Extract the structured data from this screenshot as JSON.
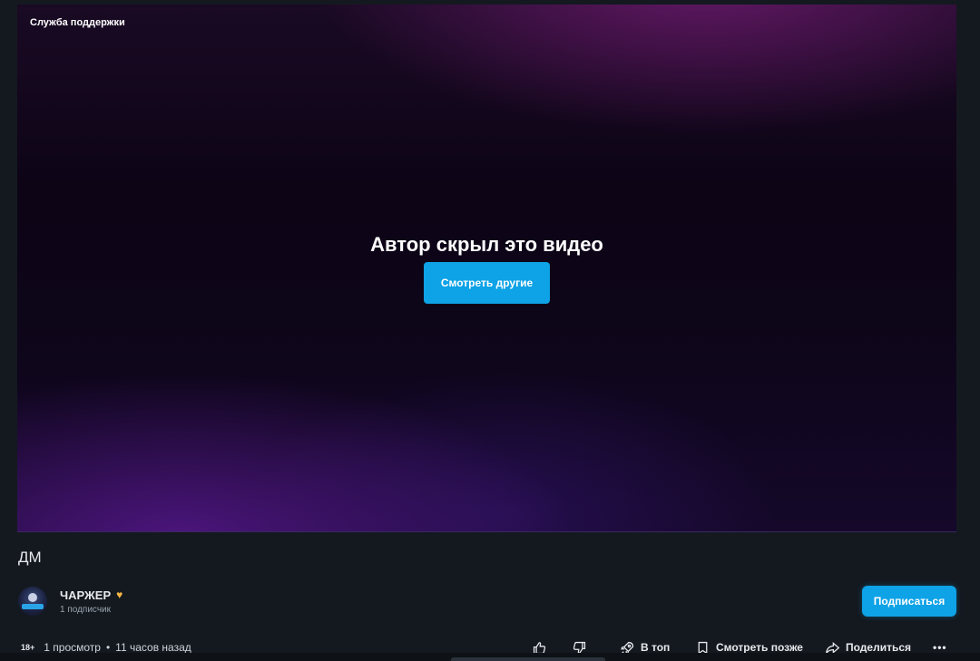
{
  "player": {
    "support_label": "Служба поддержки",
    "hidden_message": "Автор скрыл это видео",
    "watch_others_label": "Смотреть другие"
  },
  "video": {
    "title": "ДМ"
  },
  "channel": {
    "name": "ЧАРЖЕР",
    "badge_icon": "heart-icon",
    "badge_glyph": "♥",
    "subscribers": "1 подписчик",
    "subscribe_label": "Подписаться"
  },
  "stats": {
    "age_rating": "18+",
    "views": "1 просмотр",
    "separator": "•",
    "published": "11 часов назад"
  },
  "actions": {
    "like_icon": "thumbs-up-icon",
    "dislike_icon": "thumbs-down-icon",
    "top_label": "В топ",
    "watch_later_label": "Смотреть позже",
    "share_label": "Поделиться",
    "more_glyph": "•••"
  },
  "colors": {
    "accent": "#0ea2e6",
    "background": "#141920",
    "badge": "#f5b642"
  }
}
